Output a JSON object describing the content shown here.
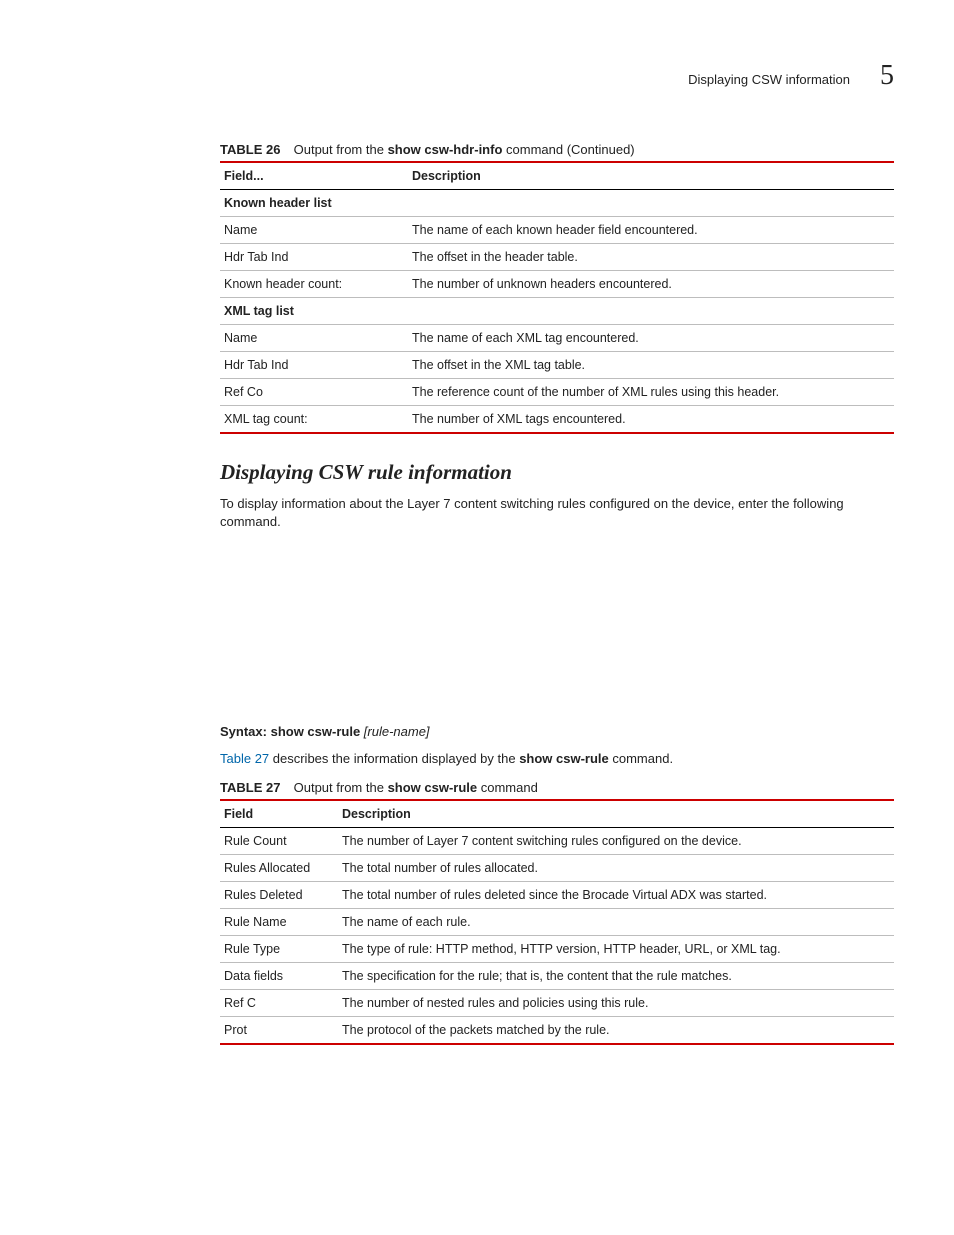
{
  "header": {
    "title": "Displaying CSW information",
    "chapter": "5"
  },
  "table26": {
    "label": "TABLE 26",
    "caption_prefix": "Output from the ",
    "caption_cmd": "show csw-hdr-info",
    "caption_suffix": " command (Continued)",
    "col1": "Field...",
    "col2": "Description",
    "rows": [
      {
        "section": true,
        "f": "Known header list",
        "d": ""
      },
      {
        "f": "Name",
        "d": "The name of each known header field encountered."
      },
      {
        "f": "Hdr Tab Ind",
        "d": "The offset in the header table."
      },
      {
        "f": "Known header count:",
        "d": "The number of unknown headers encountered."
      },
      {
        "section": true,
        "f": "XML tag list",
        "d": ""
      },
      {
        "f": "Name",
        "d": "The name of each XML tag encountered."
      },
      {
        "f": "Hdr Tab Ind",
        "d": "The offset in the XML tag table."
      },
      {
        "f": "Ref Co",
        "d": "The reference count of the number of XML rules using this header."
      },
      {
        "f": "XML tag count:",
        "d": "The number of XML tags encountered."
      }
    ]
  },
  "section": {
    "heading": "Displaying CSW rule information",
    "intro": "To display information about the Layer 7 content switching rules configured on the device, enter the following command."
  },
  "syntax": {
    "label": "Syntax:",
    "cmd": "show csw-rule",
    "arg": "[rule-name]"
  },
  "desc_para": {
    "link": "Table 27",
    "mid": " describes the information displayed by the ",
    "cmd": "show csw-rule",
    "tail": " command."
  },
  "table27": {
    "label": "TABLE 27",
    "caption_prefix": "Output from the ",
    "caption_cmd": "show csw-rule",
    "caption_suffix": " command",
    "col1": "Field",
    "col2": "Description",
    "rows": [
      {
        "f": "Rule Count",
        "d": "The number of Layer 7 content switching rules configured on the device."
      },
      {
        "f": "Rules Allocated",
        "d": "The total number of rules allocated."
      },
      {
        "f": "Rules Deleted",
        "d": "The total number of rules deleted since the Brocade Virtual ADX was started."
      },
      {
        "f": "Rule Name",
        "d": "The name of each rule."
      },
      {
        "f": "Rule Type",
        "d": "The type of rule: HTTP method, HTTP version, HTTP header, URL, or XML tag."
      },
      {
        "f": "Data fields",
        "d": "The specification for the rule; that is, the content that the rule matches."
      },
      {
        "f": "Ref C",
        "d": "The number of nested rules and policies using this rule."
      },
      {
        "f": "Prot",
        "d": "The protocol of the packets matched by the rule."
      }
    ]
  }
}
